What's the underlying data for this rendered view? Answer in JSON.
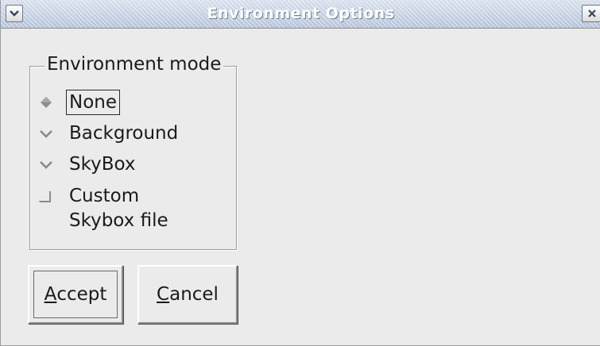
{
  "window": {
    "title": "Environment Options"
  },
  "titlebar": {
    "menu_icon": "chevron-down-icon",
    "close_icon": "close-icon"
  },
  "environment_mode": {
    "legend": "Environment mode",
    "options": [
      {
        "label": "None",
        "selected": true
      },
      {
        "label": "Background",
        "selected": false
      },
      {
        "label": "SkyBox",
        "selected": false
      }
    ],
    "custom_skybox": {
      "label_line1": "Custom",
      "label_line2": "Skybox file",
      "checked": false
    }
  },
  "buttons": {
    "accept": {
      "mnemonic": "A",
      "rest": "ccept"
    },
    "cancel": {
      "mnemonic": "C",
      "rest": "ancel"
    }
  },
  "colors": {
    "titlebar": "#c4d0e2",
    "window_bg": "#ebebeb",
    "radio_on": "#8a8a8a",
    "radio_off": "#8a8a8a"
  }
}
